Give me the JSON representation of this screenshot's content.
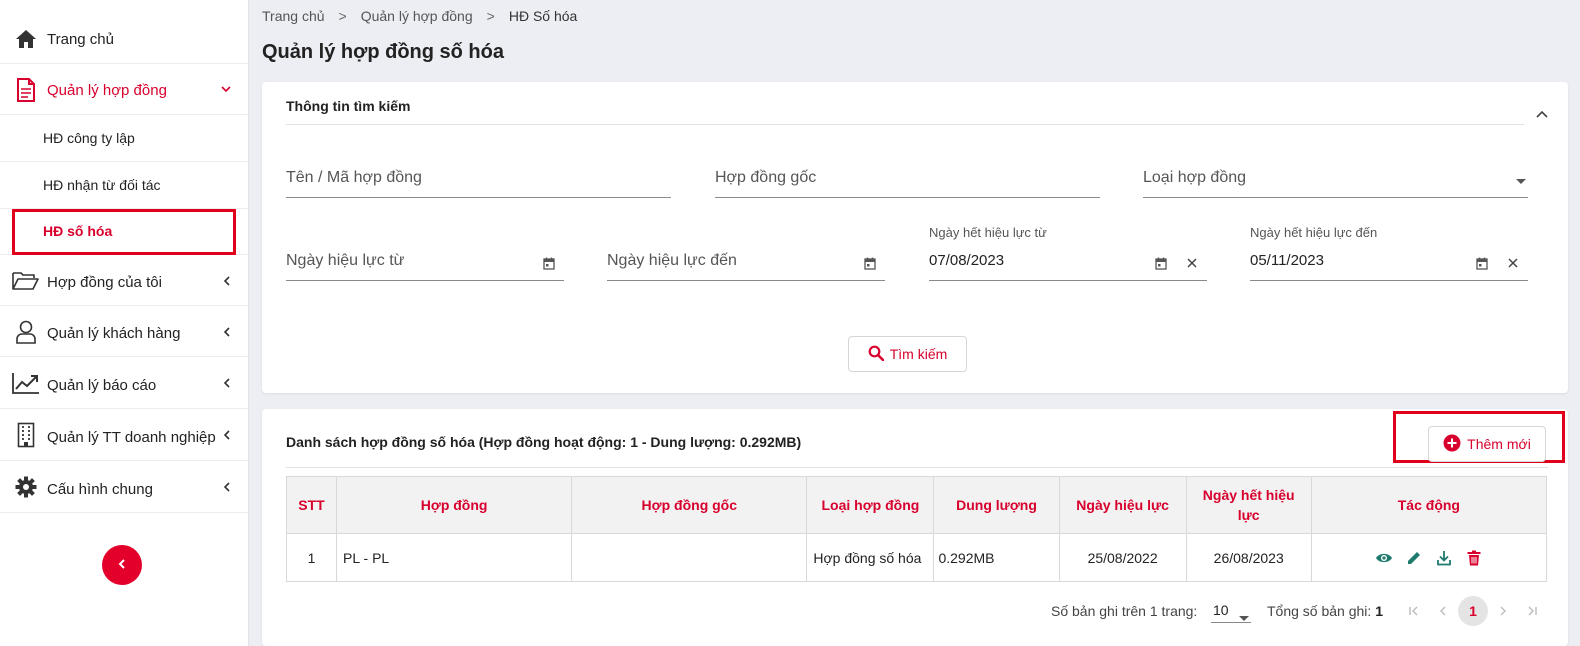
{
  "colors": {
    "accent": "#d8002c",
    "action_icon": "#1f7a6e",
    "highlight_border": "#e0001b"
  },
  "sidebar": {
    "items": [
      {
        "label": "Trang chủ",
        "icon": "home-icon"
      },
      {
        "label": "Quản lý hợp đồng",
        "icon": "document-icon",
        "active": true
      },
      {
        "label": "Hợp đồng của tôi",
        "icon": "folder-open-icon"
      },
      {
        "label": "Quản lý khách hàng",
        "icon": "user-icon"
      },
      {
        "label": "Quản lý báo cáo",
        "icon": "chart-line-icon"
      },
      {
        "label": "Quản lý TT doanh nghiệp",
        "icon": "building-icon"
      },
      {
        "label": "Cấu hình chung",
        "icon": "gear-icon"
      }
    ],
    "sub_items": [
      {
        "label": "HĐ công ty lập"
      },
      {
        "label": "HĐ nhận từ đối tác"
      },
      {
        "label": "HĐ số hóa",
        "selected": true
      }
    ]
  },
  "breadcrumb": {
    "items": [
      "Trang chủ",
      "Quản lý hợp đồng",
      "HĐ Số hóa"
    ],
    "separator": ">"
  },
  "page_title": "Quản lý hợp đồng số hóa",
  "search": {
    "title": "Thông tin tìm kiếm",
    "fields": {
      "name_code": {
        "placeholder": "Tên / Mã hợp đồng"
      },
      "original": {
        "placeholder": "Hợp đồng gốc"
      },
      "type": {
        "placeholder": "Loại hợp đồng"
      },
      "effective_from": {
        "placeholder": "Ngày hiệu lực từ"
      },
      "effective_to": {
        "placeholder": "Ngày hiệu lực đến"
      },
      "expire_from": {
        "label": "Ngày hết hiệu lực từ",
        "value": "07/08/2023"
      },
      "expire_to": {
        "label": "Ngày hết hiệu lực đến",
        "value": "05/11/2023"
      }
    },
    "button_label": "Tìm kiếm"
  },
  "list": {
    "title": "Danh sách hợp đồng số hóa  (Hợp đồng hoạt động: 1 - Dung lượng: 0.292MB)",
    "add_button": "Thêm mới",
    "columns": [
      "STT",
      "Hợp đồng",
      "Hợp đồng gốc",
      "Loại hợp đồng",
      "Dung lượng",
      "Ngày hiệu lực",
      "Ngày hết hiệu lực",
      "Tác động"
    ],
    "rows": [
      {
        "stt": "1",
        "contract": "PL - PL",
        "original": "",
        "type": "Hợp đồng số hóa",
        "size": "0.292MB",
        "effective": "25/08/2022",
        "expire": "26/08/2023",
        "actions": [
          "eye-icon",
          "pencil-icon",
          "download-icon",
          "trash-icon"
        ]
      }
    ]
  },
  "pagination": {
    "per_page_label": "Số bản ghi trên 1 trang:",
    "per_page_value": "10",
    "total_label": "Tổng số bản ghi:",
    "total_value": "1",
    "current_page": "1"
  }
}
